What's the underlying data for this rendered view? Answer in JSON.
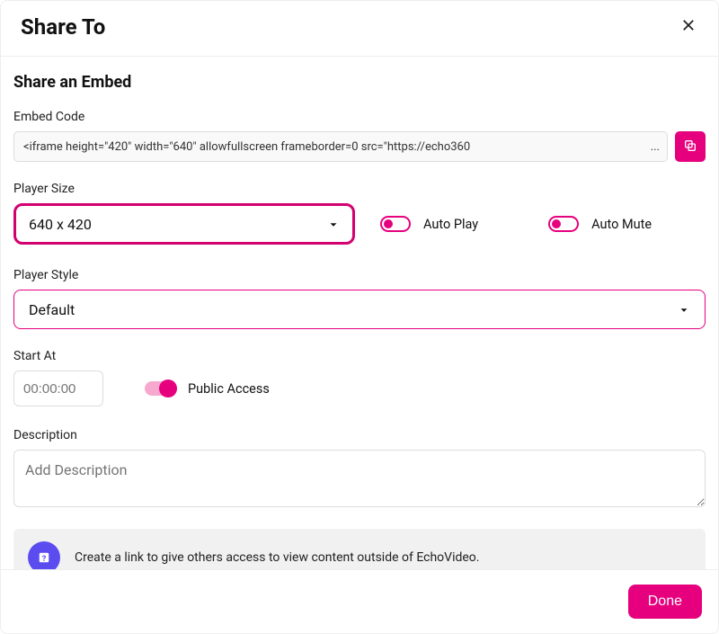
{
  "header": {
    "title": "Share To"
  },
  "section_title": "Share an Embed",
  "embed": {
    "label": "Embed Code",
    "value": "<iframe height=\"420\" width=\"640\" allowfullscreen frameborder=0 src=\"https://echo360"
  },
  "player_size": {
    "label": "Player Size",
    "selected": "640 x 420"
  },
  "auto_play": {
    "label": "Auto Play",
    "enabled": false
  },
  "auto_mute": {
    "label": "Auto Mute",
    "enabled": false
  },
  "player_style": {
    "label": "Player Style",
    "selected": "Default"
  },
  "start_at": {
    "label": "Start At",
    "placeholder": "00:00:00",
    "value": ""
  },
  "public_access": {
    "label": "Public Access",
    "enabled": true
  },
  "description": {
    "label": "Description",
    "placeholder": "Add Description",
    "value": ""
  },
  "info_banner": {
    "text": "Create a link to give others access to view content outside of EchoVideo."
  },
  "footer": {
    "done_label": "Done"
  },
  "colors": {
    "accent": "#e6007e",
    "info_icon_bg": "#5b4cf0"
  }
}
